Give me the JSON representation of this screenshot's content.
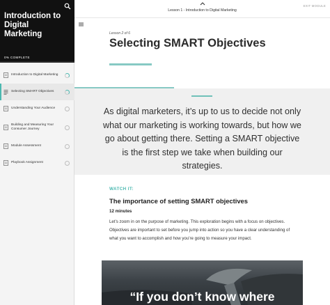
{
  "sidebar": {
    "course_title": "Introduction to Digital Marketing",
    "progress_label": "0% COMPLETE",
    "progress_fraction": 0.0,
    "lessons": [
      {
        "label": "Introduction to Digital Marketing",
        "icon": "document-icon",
        "status": "in-progress",
        "active": false
      },
      {
        "label": "Selecting SMART Objectives",
        "icon": "text-lines-icon",
        "status": "in-progress",
        "active": true
      },
      {
        "label": "Understanding Your Audience",
        "icon": "document-icon",
        "status": "not-started",
        "active": false
      },
      {
        "label": "Building and Measuring Your Consumer Journey",
        "icon": "document-icon",
        "status": "not-started",
        "active": false
      },
      {
        "label": "Module Assessment",
        "icon": "document-icon",
        "status": "not-started",
        "active": false
      },
      {
        "label": "Playbook Assignment",
        "icon": "document-icon",
        "status": "not-started",
        "active": false
      }
    ]
  },
  "topbar": {
    "title": "Lesson 1 - Introduction to Digital Marketing",
    "exit_label": "EXIT MODULE"
  },
  "lesson": {
    "kicker": "Lesson 2 of 6",
    "title": "Selecting SMART Objectives"
  },
  "quote": {
    "text": "As digital marketers, it’s up to us to decide not only what our marketing is working towards, but how we go about getting there. Setting a SMART objective is the first step we take when building our strategies."
  },
  "watch": {
    "label": "WATCH IT:",
    "title": "The importance of setting SMART objectives",
    "duration": "12 minutes",
    "body": "Let’s zoom in on the purpose of marketing. This exploration begins with a focus on objectives. Objectives are important to set before you jump into action so you have a clear understanding of what you want to accomplish and how you’re going to measure your impact."
  },
  "video": {
    "caption": "“If you don’t know where"
  },
  "colors": {
    "accent": "#4bb8b0",
    "sidebar_header": "#111111",
    "quote_background": "#f0f0f0"
  }
}
